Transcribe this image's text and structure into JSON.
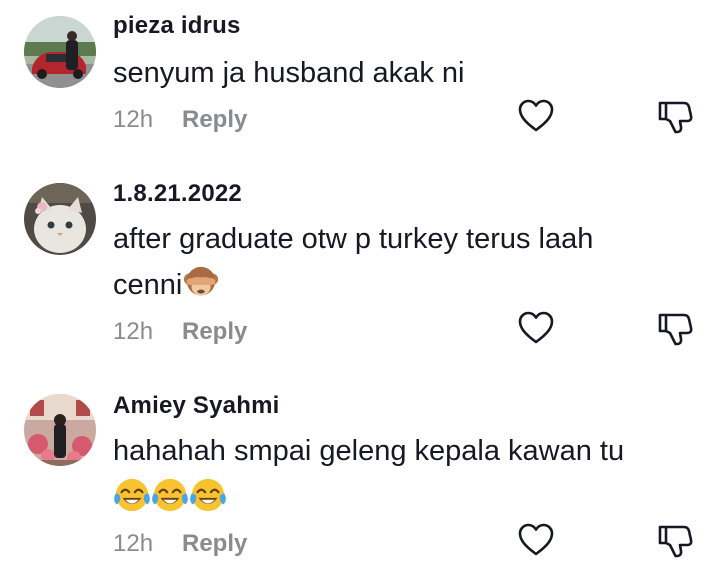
{
  "comments": [
    {
      "username": "pieza idrus",
      "text": "senyum ja husband akak ni",
      "time": "12h",
      "reply_label": "Reply",
      "avatar_icon": "avatar-photo-car"
    },
    {
      "username": "1.8.21.2022",
      "text_line1": "after graduate otw p turkey terus laah",
      "text_line2": "cenni",
      "emoji": "see-no-evil-monkey-emoji",
      "time": "12h",
      "reply_label": "Reply",
      "avatar_icon": "avatar-photo-cat"
    },
    {
      "username": "Amiey Syahmi",
      "text": "hahahah smpai geleng kepala kawan tu",
      "emojis": [
        "face-with-tears-of-joy-emoji",
        "face-with-tears-of-joy-emoji",
        "face-with-tears-of-joy-emoji"
      ],
      "time": "12h",
      "reply_label": "Reply",
      "avatar_icon": "avatar-photo-person"
    }
  ],
  "icons": {
    "like": "heart-outline-icon",
    "dislike": "thumbs-down-outline-icon"
  },
  "colors": {
    "primary_text": "#161823",
    "secondary_text": "#8a8b91",
    "icon_stroke": "#161823"
  }
}
